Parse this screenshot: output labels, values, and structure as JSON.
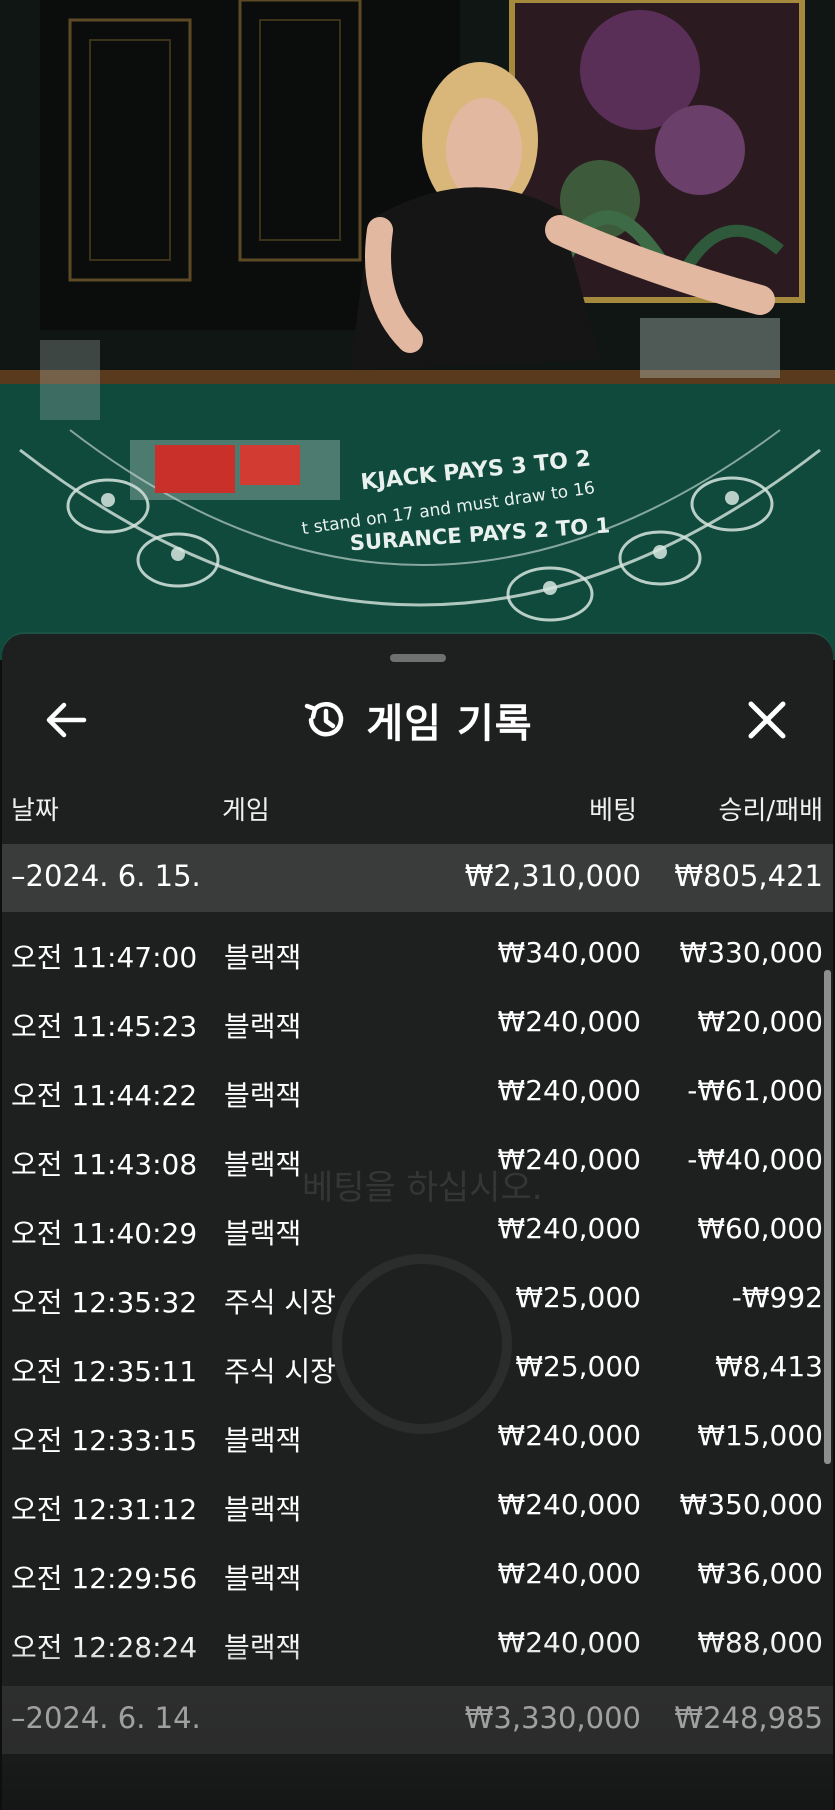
{
  "sheet": {
    "title": "게임 기록",
    "back_icon": "arrow-left-icon",
    "history_icon": "history-icon",
    "close_icon": "close-icon"
  },
  "columns": {
    "date": "날짜",
    "game": "게임",
    "bet": "베팅",
    "result": "승리/패배"
  },
  "groups": [
    {
      "date": "–2024. 6. 15.",
      "total_bet": "₩2,310,000",
      "total_result": "₩805,421",
      "rows": [
        {
          "time": "오전 11:47:00",
          "game": "블랙잭",
          "bet": "₩340,000",
          "result": "₩330,000"
        },
        {
          "time": "오전 11:45:23",
          "game": "블랙잭",
          "bet": "₩240,000",
          "result": "₩20,000"
        },
        {
          "time": "오전 11:44:22",
          "game": "블랙잭",
          "bet": "₩240,000",
          "result": "-₩61,000"
        },
        {
          "time": "오전 11:43:08",
          "game": "블랙잭",
          "bet": "₩240,000",
          "result": "-₩40,000"
        },
        {
          "time": "오전 11:40:29",
          "game": "블랙잭",
          "bet": "₩240,000",
          "result": "₩60,000"
        },
        {
          "time": "오전 12:35:32",
          "game": "주식 시장",
          "bet": "₩25,000",
          "result": "-₩992"
        },
        {
          "time": "오전 12:35:11",
          "game": "주식 시장",
          "bet": "₩25,000",
          "result": "₩8,413"
        },
        {
          "time": "오전 12:33:15",
          "game": "블랙잭",
          "bet": "₩240,000",
          "result": "₩15,000"
        },
        {
          "time": "오전 12:31:12",
          "game": "블랙잭",
          "bet": "₩240,000",
          "result": "₩350,000"
        },
        {
          "time": "오전 12:29:56",
          "game": "블랙잭",
          "bet": "₩240,000",
          "result": "₩36,000"
        },
        {
          "time": "오전 12:28:24",
          "game": "블랙잭",
          "bet": "₩240,000",
          "result": "₩88,000"
        }
      ]
    },
    {
      "date": "–2024. 6. 14.",
      "total_bet": "₩3,330,000",
      "total_result": "₩248,985",
      "rows": []
    }
  ],
  "table_felt": {
    "line1": "KJACK PAYS 3 TO 2",
    "line2": "t stand on 17 and must draw to 16",
    "line3": "SURANCE PAYS 2 TO 1"
  },
  "ghost": {
    "prompt": "베팅을 하십시오."
  },
  "colors": {
    "sheet_bg": "#1e1f1f",
    "date_row_bg": "#3a3b3b",
    "felt": "#0f4a3c",
    "text": "#ffffff"
  }
}
